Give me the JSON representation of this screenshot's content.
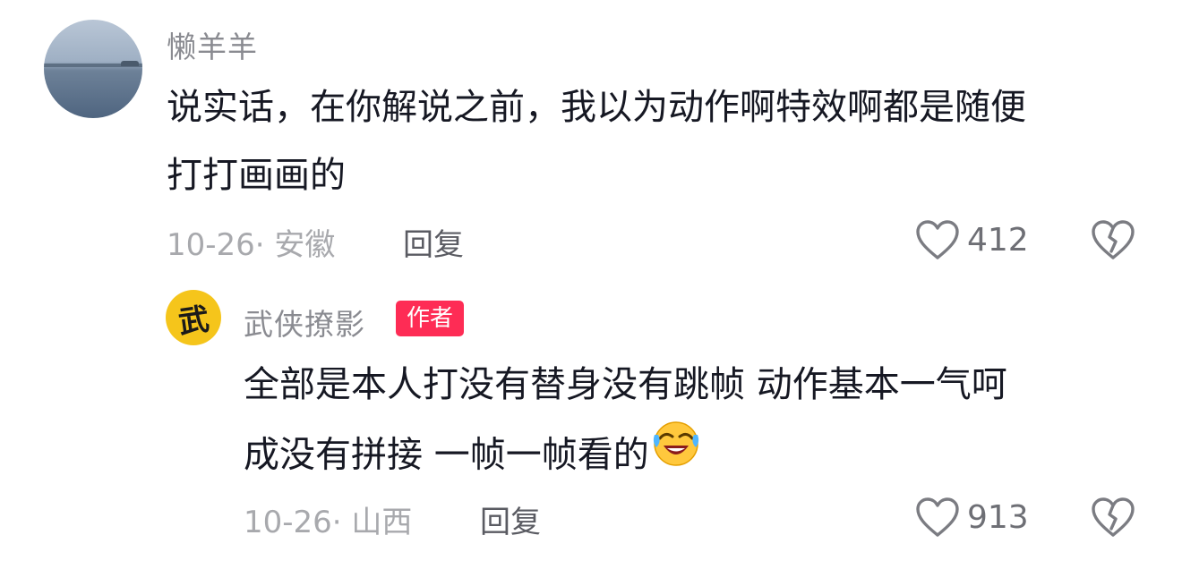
{
  "comment": {
    "username": "懒羊羊",
    "text_line1": "说实话，在你解说之前，我以为动作啊特效啊都是随便",
    "text_line2": "打打画画的",
    "date_location": "10-26· 安徽",
    "reply_label": "回复",
    "like_count": "412"
  },
  "reply": {
    "avatar_char": "武",
    "username": "武侠撩影",
    "author_badge": "作者",
    "text_line1": "全部是本人打没有替身没有跳帧 动作基本一气呵",
    "text_line2": "成没有拼接  一帧一帧看的",
    "emoji": "laughing-crying-emoji",
    "date_location": "10-26· 山西",
    "reply_label": "回复",
    "like_count": "913"
  },
  "colors": {
    "badge": "#fe2c55",
    "avatar_reply_bg": "#f5c51b",
    "meta_gray": "#a8a9ad",
    "username_gray": "#8a8b91"
  }
}
